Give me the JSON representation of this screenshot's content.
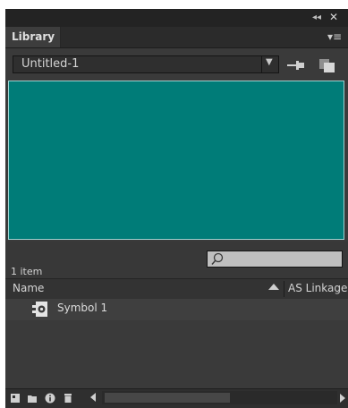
{
  "panel": {
    "tab_label": "Library",
    "collapse_glyph": "◂◂",
    "close_glyph": "✕",
    "menu_glyph": "▾≡"
  },
  "document_select": {
    "value": "Untitled-1",
    "arrow_glyph": "▼"
  },
  "icons": {
    "pin": "pin-icon",
    "new_library_panel": "new-library-panel-icon",
    "search": "magnifier-icon",
    "sort": "sort-ascending-icon",
    "symbol": "movie-clip-symbol-icon"
  },
  "preview": {
    "background_color": "#007c78"
  },
  "status": {
    "item_count": "1 item"
  },
  "search": {
    "value": ""
  },
  "columns": {
    "name": "Name",
    "linkage": "AS Linkage"
  },
  "items": [
    {
      "label": "Symbol 1",
      "type": "movie clip"
    }
  ],
  "bottom_toolbar": [
    "new-symbol-icon",
    "new-folder-icon",
    "properties-icon",
    "delete-icon"
  ]
}
